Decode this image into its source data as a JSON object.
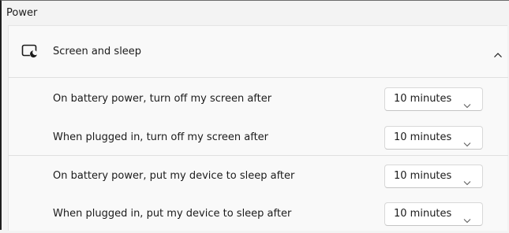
{
  "page": {
    "title": "Power"
  },
  "section": {
    "title": "Screen and sleep",
    "icon": "screen-sleep-icon",
    "expanded": true
  },
  "settings": [
    {
      "label": "On battery power, turn off my screen after",
      "value": "10 minutes"
    },
    {
      "label": "When plugged in, turn off my screen after",
      "value": "10 minutes"
    },
    {
      "label": "On battery power, put my device to sleep after",
      "value": "10 minutes"
    },
    {
      "label": "When plugged in, put my device to sleep after",
      "value": "10 minutes"
    }
  ]
}
